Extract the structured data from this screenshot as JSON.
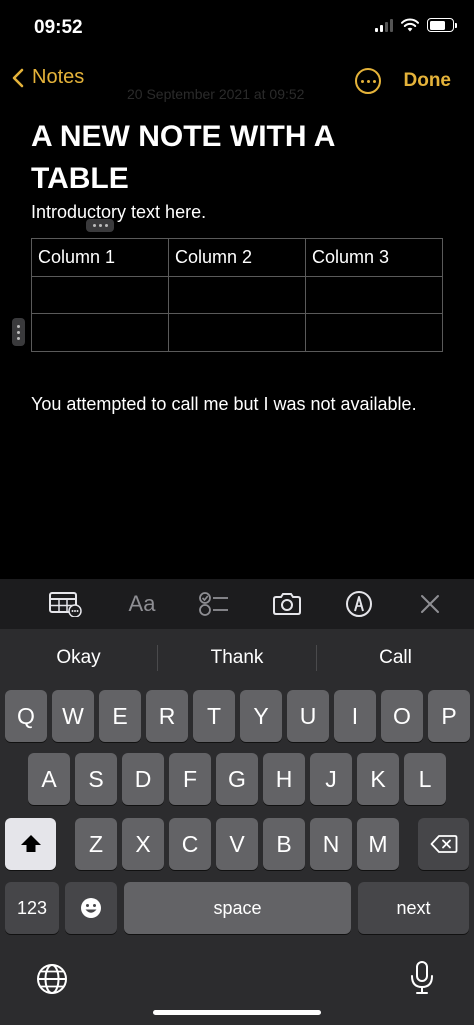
{
  "status_bar": {
    "time": "09:52"
  },
  "nav": {
    "back_label": "Notes",
    "faint_date": "20 September 2021 at 09:52",
    "done_label": "Done",
    "accent_color": "#e5b33a"
  },
  "note": {
    "title": "A NEW NOTE WITH A TABLE",
    "intro": "Introductory text here.",
    "table": {
      "headers": [
        "Column 1",
        "Column 2",
        "Column 3"
      ],
      "rows": [
        [
          "",
          "",
          ""
        ],
        [
          "",
          "",
          ""
        ]
      ]
    },
    "body": "You attempted to call me but I was not available."
  },
  "format_toolbar": {
    "items": [
      "table-icon",
      "text-format-icon",
      "checklist-icon",
      "camera-icon",
      "markup-icon",
      "close-icon"
    ],
    "text_format_label": "Aa"
  },
  "keyboard": {
    "suggestions": [
      "Okay",
      "Thank",
      "Call"
    ],
    "row1": [
      "Q",
      "W",
      "E",
      "R",
      "T",
      "Y",
      "U",
      "I",
      "O",
      "P"
    ],
    "row2": [
      "A",
      "S",
      "D",
      "F",
      "G",
      "H",
      "J",
      "K",
      "L"
    ],
    "row3": [
      "Z",
      "X",
      "C",
      "V",
      "B",
      "N",
      "M"
    ],
    "numbers_label": "123",
    "space_label": "space",
    "next_label": "next"
  }
}
